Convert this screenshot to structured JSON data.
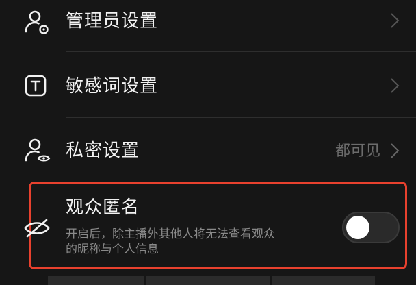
{
  "settings": {
    "admin": {
      "label": "管理员设置",
      "icon": "person-gear-icon"
    },
    "sensitive_words": {
      "label": "敏感词设置",
      "icon": "text-box-icon"
    },
    "privacy": {
      "label": "私密设置",
      "value": "都可见",
      "icon": "person-eye-icon"
    },
    "anonymous_audience": {
      "label": "观众匿名",
      "description_line1": "开启后，除主播外其他人将无法查看观众",
      "description_line2": "的昵称与个人信息",
      "icon": "eye-off-icon",
      "enabled": false
    }
  },
  "colors": {
    "background": "#161616",
    "highlight_border": "#e8412e",
    "secondary_text": "#8a8a8a"
  }
}
